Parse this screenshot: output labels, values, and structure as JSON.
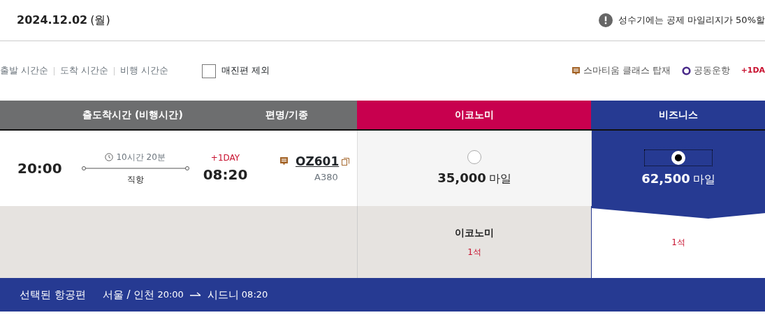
{
  "header": {
    "date": "2024.12.02",
    "weekday": "(월)",
    "notice": "성수기에는 공제 마일리지가 50%할"
  },
  "sort_options": [
    "출발 시간순",
    "도착 시간순",
    "비행 시간순"
  ],
  "exclude_sold_out": {
    "label": "매진편 제외",
    "checked": false
  },
  "legend": [
    {
      "kind": "smartium",
      "label": "스마티움 클래스 탑재"
    },
    {
      "kind": "codeshare",
      "label": "공동운항"
    },
    {
      "kind": "nextday",
      "label": "+1DA"
    }
  ],
  "table": {
    "columns": [
      "출도착시간 (비행시간)",
      "편명/기종",
      "이코노미",
      "비즈니스"
    ],
    "flight": {
      "departure": "20:00",
      "duration": "10시간 20분",
      "stops": "직항",
      "next_day": "+1DAY",
      "arrival": "08:20",
      "flight_no": "OZ601",
      "aircraft": "A380"
    },
    "fares": [
      {
        "miles": "35,000",
        "unit": "마일",
        "selected": false
      },
      {
        "miles": "62,500",
        "unit": "마일",
        "selected": true
      }
    ],
    "seats": [
      {
        "class_name": "이코노미",
        "count": "1석"
      },
      {
        "count": "1석"
      }
    ]
  },
  "footer": {
    "title": "선택된 항공편",
    "from": "서울 / 인천",
    "dep": "20:00",
    "to": "시드니",
    "arr": "08:20"
  }
}
